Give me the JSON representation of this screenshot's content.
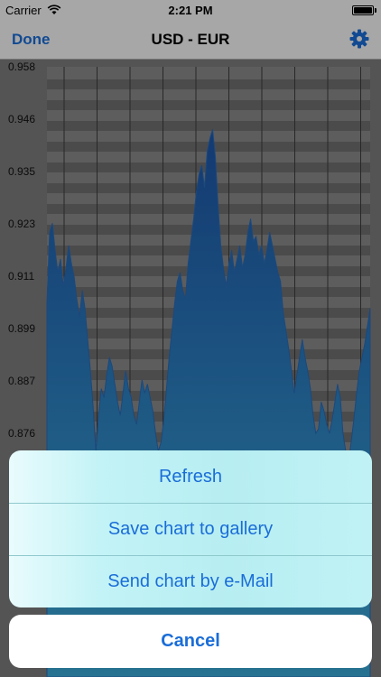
{
  "status_bar": {
    "carrier": "Carrier",
    "time": "2:21 PM"
  },
  "nav": {
    "done_label": "Done",
    "title": "USD - EUR",
    "settings_icon": "gear-icon"
  },
  "chart_data": {
    "type": "area",
    "title": "USD - EUR",
    "xlabel": "",
    "ylabel": "",
    "ylim": [
      0.864,
      0.958
    ],
    "y_ticks": [
      "0.958",
      "0.946",
      "0.935",
      "0.923",
      "0.911",
      "0.899",
      "0.887",
      "0.876"
    ],
    "grid": true,
    "color": "#1d62b0",
    "x": [
      0,
      1,
      2,
      3,
      4,
      5,
      6,
      7,
      8,
      9,
      10,
      11,
      12,
      13,
      14,
      15,
      16,
      17,
      18,
      19,
      20,
      21,
      22,
      23,
      24,
      25,
      26,
      27,
      28,
      29,
      30,
      31,
      32,
      33,
      34,
      35,
      36,
      37,
      38,
      39,
      40,
      41,
      42,
      43,
      44,
      45,
      46,
      47,
      48,
      49,
      50,
      51,
      52,
      53,
      54,
      55,
      56,
      57,
      58,
      59,
      60,
      61,
      62,
      63,
      64,
      65,
      66,
      67,
      68,
      69,
      70,
      71,
      72,
      73,
      74,
      75,
      76,
      77,
      78,
      79,
      80,
      81,
      82,
      83,
      84,
      85,
      86,
      87,
      88,
      89,
      90,
      91,
      92,
      93,
      94,
      95,
      96,
      97,
      98,
      99,
      100,
      101,
      102,
      103,
      104,
      105,
      106,
      107,
      108,
      109,
      110,
      111,
      112,
      113,
      114,
      115,
      116,
      117,
      118,
      119
    ],
    "values": [
      0.905,
      0.921,
      0.923,
      0.917,
      0.912,
      0.915,
      0.909,
      0.913,
      0.918,
      0.914,
      0.911,
      0.906,
      0.902,
      0.908,
      0.904,
      0.897,
      0.89,
      0.882,
      0.872,
      0.88,
      0.886,
      0.884,
      0.889,
      0.893,
      0.891,
      0.887,
      0.883,
      0.88,
      0.885,
      0.89,
      0.886,
      0.884,
      0.88,
      0.878,
      0.883,
      0.888,
      0.885,
      0.887,
      0.884,
      0.881,
      0.876,
      0.872,
      0.874,
      0.879,
      0.886,
      0.893,
      0.899,
      0.905,
      0.91,
      0.912,
      0.908,
      0.906,
      0.914,
      0.919,
      0.924,
      0.93,
      0.934,
      0.936,
      0.931,
      0.939,
      0.942,
      0.944,
      0.938,
      0.927,
      0.918,
      0.913,
      0.909,
      0.914,
      0.917,
      0.912,
      0.915,
      0.918,
      0.913,
      0.916,
      0.921,
      0.924,
      0.919,
      0.92,
      0.916,
      0.918,
      0.914,
      0.917,
      0.921,
      0.918,
      0.915,
      0.912,
      0.91,
      0.903,
      0.899,
      0.895,
      0.89,
      0.885,
      0.889,
      0.893,
      0.897,
      0.893,
      0.89,
      0.886,
      0.88,
      0.876,
      0.877,
      0.883,
      0.881,
      0.878,
      0.876,
      0.879,
      0.883,
      0.887,
      0.884,
      0.876,
      0.872,
      0.869,
      0.874,
      0.879,
      0.885,
      0.89,
      0.893,
      0.896,
      0.9,
      0.904
    ]
  },
  "action_sheet": {
    "options": [
      "Refresh",
      "Save chart to gallery",
      "Send chart by e-Mail"
    ],
    "cancel_label": "Cancel"
  }
}
